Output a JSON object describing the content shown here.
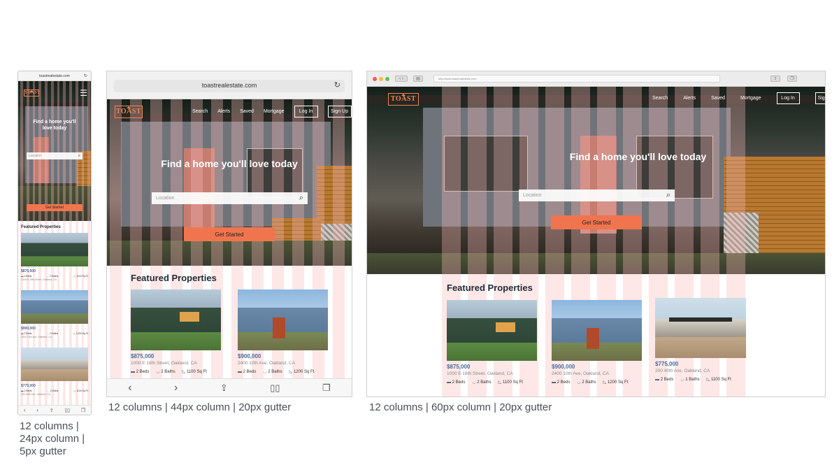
{
  "site": {
    "url": "toastrealestate.com",
    "desktop_url": "http://www.toastrealestate.com",
    "logo_text": "TOAST",
    "hero_title": "Find a home you'll love today",
    "hero_title_mobile_line1": "Find a home you'll",
    "hero_title_mobile_line2": "love today",
    "search_placeholder": "Location",
    "cta_label": "Get Started",
    "featured_title": "Featured Properties"
  },
  "nav": {
    "links": [
      "Search",
      "Alerts",
      "Saved",
      "Mortgage"
    ],
    "login_label": "Log In",
    "signup_label": "Sign Up"
  },
  "properties": [
    {
      "price": "$875,000",
      "address": "1000 E 18th Street, Oakland, CA",
      "beds": "2 Beds",
      "baths": "2 Baths",
      "sqft": "1100 Sq Ft"
    },
    {
      "price": "$900,000",
      "address": "2400 10th Ave, Oakland, CA",
      "beds": "2 Beds",
      "baths": "2 Baths",
      "sqft": "1200 Sq Ft"
    },
    {
      "price": "$775,000",
      "address": "200 40th Ave, Oakland, CA",
      "beds": "2 Beds",
      "baths": "1 Baths",
      "sqft": "1100 Sq Ft"
    }
  ],
  "captions": {
    "mobile_line1": "12 columns |",
    "mobile_line2": "24px column |",
    "mobile_line3": "5px gutter",
    "tablet": "12 columns | 44px column | 20px gutter",
    "desktop": "12 columns | 60px column | 20px gutter"
  },
  "icons": {
    "menu": "hamburger-icon",
    "search": "magnifier-icon",
    "reload": "reload-icon",
    "back": "chevron-left-icon",
    "forward": "chevron-right-icon",
    "share": "share-icon",
    "bookmarks": "book-icon",
    "tabs": "tabs-icon",
    "bed": "bed-icon",
    "bath": "bathtub-icon",
    "area": "ruler-triangle-icon"
  },
  "colors": {
    "accent": "#f0754f",
    "logo": "#f0844f",
    "price": "#4a6a9a",
    "grid_overlay": "#fab9b9"
  }
}
